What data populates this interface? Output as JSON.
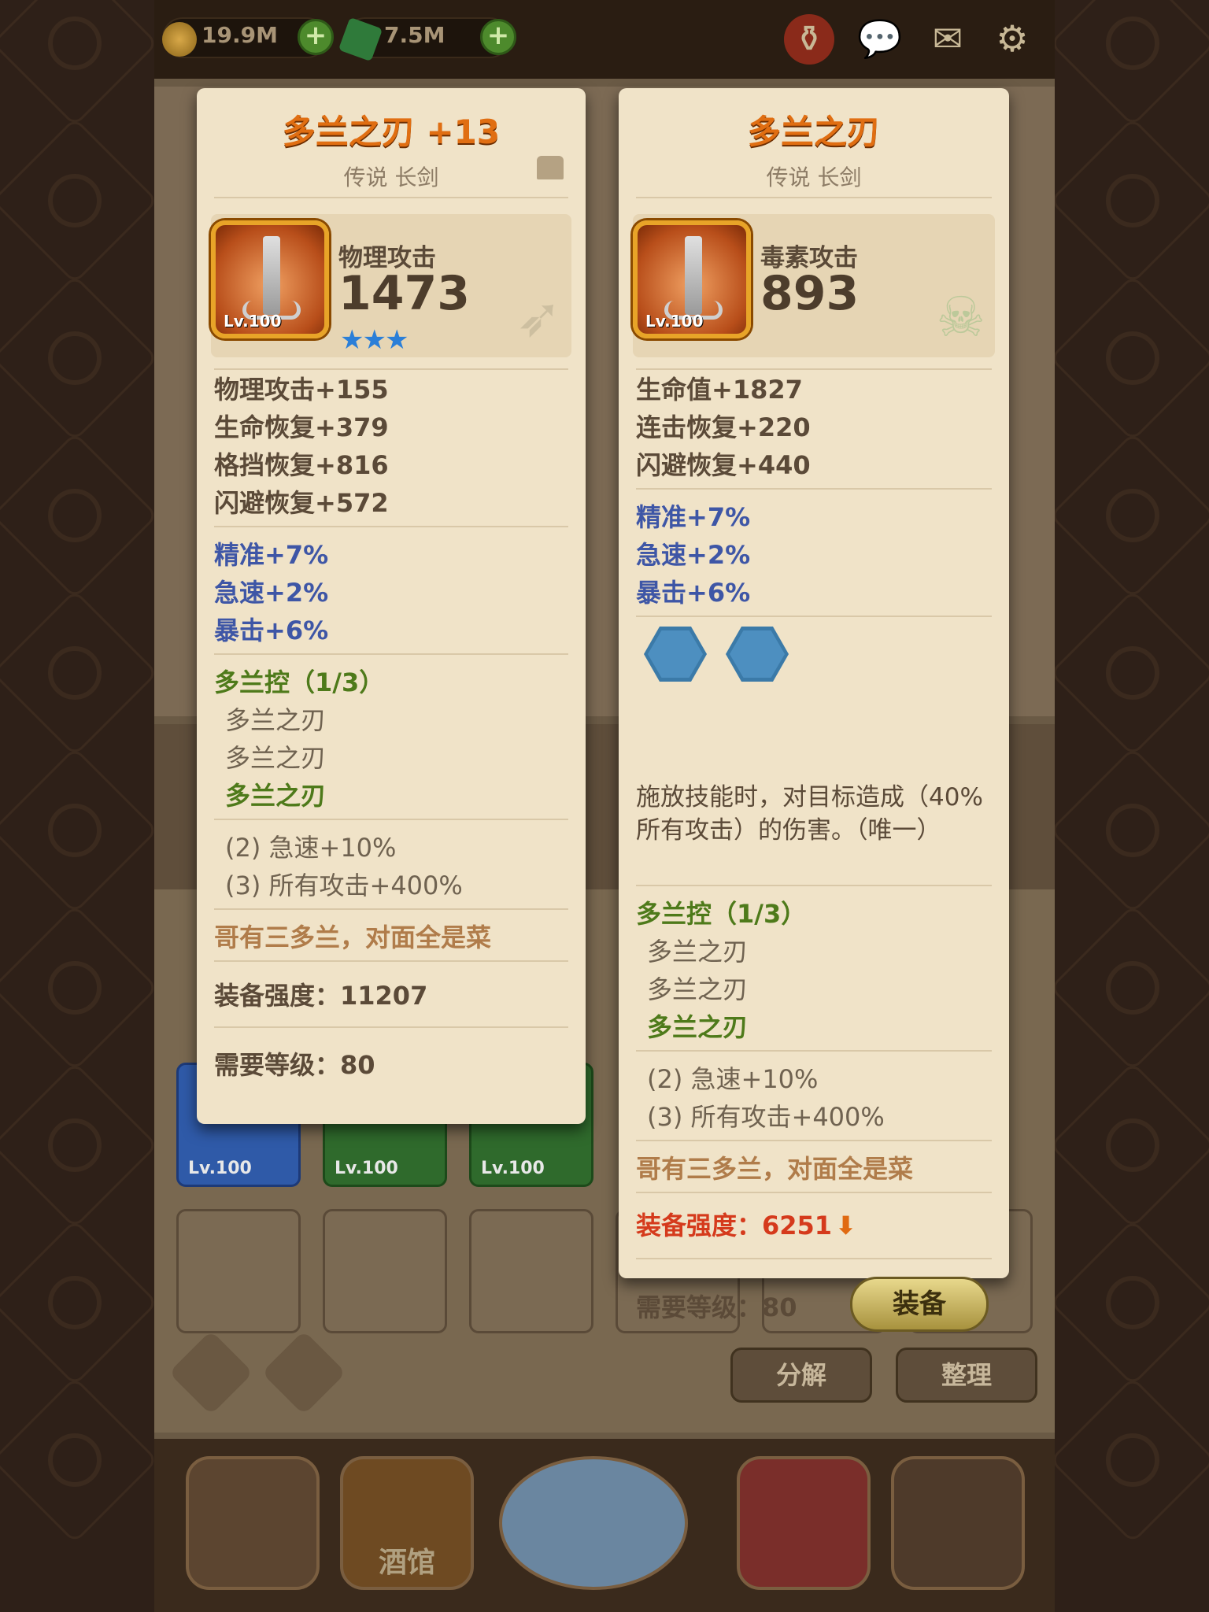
{
  "topbar": {
    "gold": "19.9M",
    "gems": "7.5M",
    "plus": "+"
  },
  "nav": {
    "tavern_label": "酒馆"
  },
  "buttons": {
    "decompose": "分解",
    "organize": "整理"
  },
  "slots": [
    {
      "level": "Lv.100"
    },
    {
      "level": "Lv.100"
    },
    {
      "level": "Lv.100"
    }
  ],
  "card_left": {
    "title": "多兰之刃 +13",
    "subtitle": "传说 长剑",
    "icon_level": "Lv.100",
    "main_stat_name": "物理攻击",
    "main_stat_value": "1473",
    "stars": "★★★",
    "stats": [
      "物理攻击+155",
      "生命恢复+379",
      "格挡恢复+816",
      "闪避恢复+572"
    ],
    "bonus": [
      "精准+7%",
      "急速+2%",
      "暴击+6%"
    ],
    "set_title": "多兰控（1/3）",
    "set_items": [
      "多兰之刃",
      "多兰之刃",
      "多兰之刃"
    ],
    "set_bonus": [
      "(2) 急速+10%",
      "(3) 所有攻击+400%"
    ],
    "flavor": "哥有三多兰，对面全是菜",
    "power": "装备强度：11207",
    "req": "需要等级：80"
  },
  "card_right": {
    "title": "多兰之刃",
    "subtitle": "传说 长剑",
    "icon_level": "Lv.100",
    "main_stat_name": "毒素攻击",
    "main_stat_value": "893",
    "stats": [
      "生命值+1827",
      "连击恢复+220",
      "闪避恢复+440"
    ],
    "bonus": [
      "精准+7%",
      "急速+2%",
      "暴击+6%"
    ],
    "skill_text": "施放技能时，对目标造成（40%所有攻击）的伤害。（唯一）",
    "set_title": "多兰控（1/3）",
    "set_items": [
      "多兰之刃",
      "多兰之刃",
      "多兰之刃"
    ],
    "set_bonus": [
      "(2) 急速+10%",
      "(3) 所有攻击+400%"
    ],
    "flavor": "哥有三多兰，对面全是菜",
    "power": "装备强度：6251",
    "req": "需要等级：80",
    "equip_label": "装备"
  },
  "colors": {
    "accent_title": "#e06e12",
    "bonus_blue": "#3e56a6",
    "set_green": "#4e7a1a",
    "power_red": "#d53a1c"
  }
}
